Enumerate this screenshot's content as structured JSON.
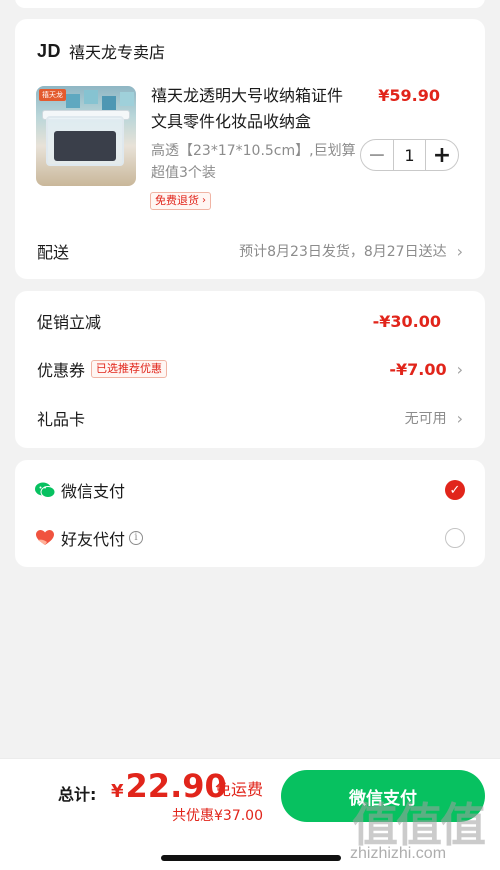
{
  "store": {
    "logo_text": "JD",
    "name": "禧天龙专卖店"
  },
  "product": {
    "image_brand_tag": "禧天龙",
    "title": "禧天龙透明大号收纳箱证件文具零件化妆品收纳盒",
    "price": "¥59.90",
    "spec": "高透【23*17*10.5cm】,巨划算超值3个装",
    "return_tag": "免费退货",
    "quantity": "1",
    "minus": "−",
    "plus": "+"
  },
  "delivery": {
    "label": "配送",
    "value": "预计8月23日发货，8月27日送达"
  },
  "promotions": {
    "instant_discount": {
      "label": "促销立减",
      "value": "-¥30.00"
    },
    "coupon": {
      "label": "优惠券",
      "tag": "已选推荐优惠",
      "value": "-¥7.00"
    },
    "gift_card": {
      "label": "礼品卡",
      "value": "无可用"
    }
  },
  "payment": {
    "wechat": {
      "label": "微信支付",
      "selected": true,
      "icon": "wechat-icon"
    },
    "friend": {
      "label": "好友代付",
      "selected": false,
      "icon": "heart-hand-icon",
      "info": "i"
    }
  },
  "footer": {
    "total_label": "总计:",
    "currency": "¥",
    "total": "22.90",
    "free_shipping": "免运费",
    "saving": "共优惠¥37.00",
    "pay_button": "微信支付"
  },
  "watermark": {
    "logo": "值值值",
    "site": "zhizhizhi.com"
  },
  "colors": {
    "accent_red": "#e1251b",
    "wechat_green": "#07c160"
  }
}
